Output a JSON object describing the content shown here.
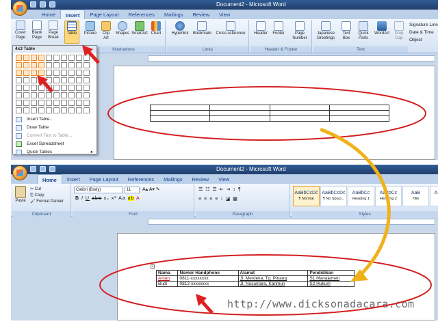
{
  "top_window": {
    "title": "Document2 - Microsoft Word",
    "tabs": [
      "Home",
      "Insert",
      "Page Layout",
      "References",
      "Mailings",
      "Review",
      "View"
    ],
    "active_tab": "Insert",
    "pages_buttons": [
      "Cover Page",
      "Blank Page",
      "Page Break"
    ],
    "table_button": "Table",
    "illustration_buttons": [
      "Picture",
      "Clip Art",
      "Shapes",
      "SmartArt",
      "Chart"
    ],
    "links_buttons": [
      "Hyperlink",
      "Bookmark",
      "Cross-reference"
    ],
    "header_footer_buttons": [
      "Header",
      "Footer",
      "Page Number"
    ],
    "text_buttons": [
      "Japanese Greetings",
      "Text Box",
      "Quick Parts",
      "WordArt",
      "Drop Cap"
    ],
    "side_items": [
      "Signature Line",
      "Date & Time",
      "Object"
    ],
    "group_labels": [
      "Illustrations",
      "Links",
      "Header & Footer",
      "Text"
    ],
    "picker": {
      "title": "4x3 Table",
      "menu": [
        "Insert Table...",
        "Draw Table",
        "Convert Text to Table...",
        "Excel Spreadsheet",
        "Quick Tables"
      ]
    }
  },
  "bottom_window": {
    "title": "Document2 - Microsoft Word",
    "tabs": [
      "Home",
      "Insert",
      "Page Layout",
      "References",
      "Mailings",
      "Review",
      "View"
    ],
    "active_tab": "Home",
    "clipboard": {
      "paste": "Paste",
      "cut": "Cut",
      "copy": "Copy",
      "format_painter": "Format Painter",
      "label": "Clipboard"
    },
    "font": {
      "name": "Calibri (Body)",
      "size": "11",
      "label": "Font"
    },
    "paragraph_label": "Paragraph",
    "styles_label": "Styles",
    "styles": [
      {
        "preview": "AaBbCcDc",
        "name": "¶ Normal"
      },
      {
        "preview": "AaBbCcDc",
        "name": "¶ No Spaci..."
      },
      {
        "preview": "AaBbCc",
        "name": "Heading 1"
      },
      {
        "preview": "AaBbCc",
        "name": "Heading 2"
      },
      {
        "preview": "AaB",
        "name": "Title"
      },
      {
        "preview": "AaBbCc",
        "name": "Su"
      }
    ],
    "table": {
      "headers": [
        "Nama",
        "Nomor Handphone",
        "Alamat",
        "Pendidikan"
      ],
      "rows": [
        [
          "Aman",
          "0811-xxxxxxxx",
          "Jl. Merdeka, Tg. Pinang",
          "S1 Manajemen"
        ],
        [
          "Budi",
          "0812-xxxxxxxx",
          "Jl. Nusantara, Karimun",
          "S2 Hukum"
        ]
      ]
    }
  },
  "watermark": "http://www.dicksonadacara.com",
  "colors": {
    "ellipse": "#d42020",
    "curved_arrow": "#f0b21a",
    "red_arrow": "#e02020"
  }
}
